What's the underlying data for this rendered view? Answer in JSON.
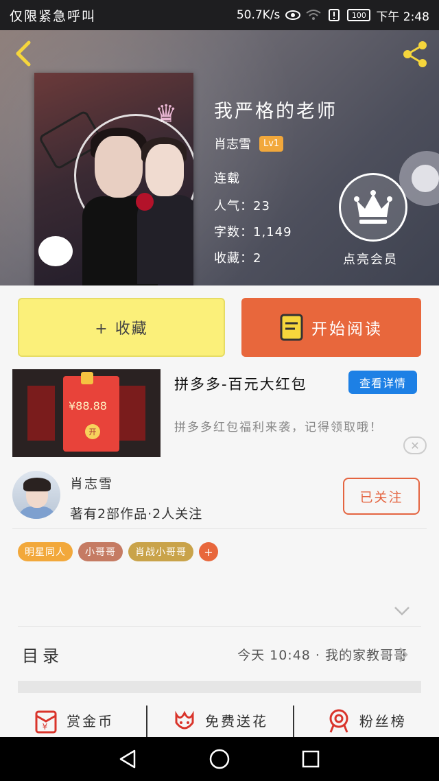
{
  "status_bar": {
    "carrier": "仅限紧急呼叫",
    "speed": "50.7K/s",
    "battery": "100",
    "time": "下午 2:48"
  },
  "book": {
    "title": "我严格的老师",
    "author": "肖志雪",
    "level": "Lv1",
    "status": "连载",
    "popularity_label": "人气：",
    "popularity": "23",
    "words_label": "字数：",
    "words": "1,149",
    "favorites_label": "收藏：",
    "favorites": "2"
  },
  "vip": {
    "label": "点亮会员"
  },
  "actions": {
    "collect": "+ 收藏",
    "read": "开始阅读"
  },
  "ad": {
    "title": "拼多多-百元大红包",
    "detail_button": "查看详情",
    "description": "拼多多红包福利来袭，记得领取哦！",
    "amount": "¥88.88",
    "open_label": "开"
  },
  "author_card": {
    "name": "肖志雪",
    "stats": "著有2部作品·2人关注",
    "follow_button": "已关注"
  },
  "tags": [
    {
      "label": "明星同人",
      "color": "#f2a83b"
    },
    {
      "label": "小哥哥",
      "color": "#c57b63"
    },
    {
      "label": "肖战小哥哥",
      "color": "#c9a34a"
    }
  ],
  "tag_add": {
    "label": "+",
    "color": "#e8673c"
  },
  "toc": {
    "label": "目录",
    "latest": "今天 10:48 · 我的家教哥哥"
  },
  "bottom_actions": [
    {
      "label": "赏金币",
      "icon": "red-envelope-icon"
    },
    {
      "label": "免费送花",
      "icon": "flower-icon"
    },
    {
      "label": "粉丝榜",
      "icon": "medal-icon"
    }
  ],
  "colors": {
    "collect_bg": "#fbf07a",
    "read_bg": "#e8673c",
    "detail_bg": "#1d80e5",
    "follow": "#e46440",
    "level_badge": "#f2a83b"
  }
}
